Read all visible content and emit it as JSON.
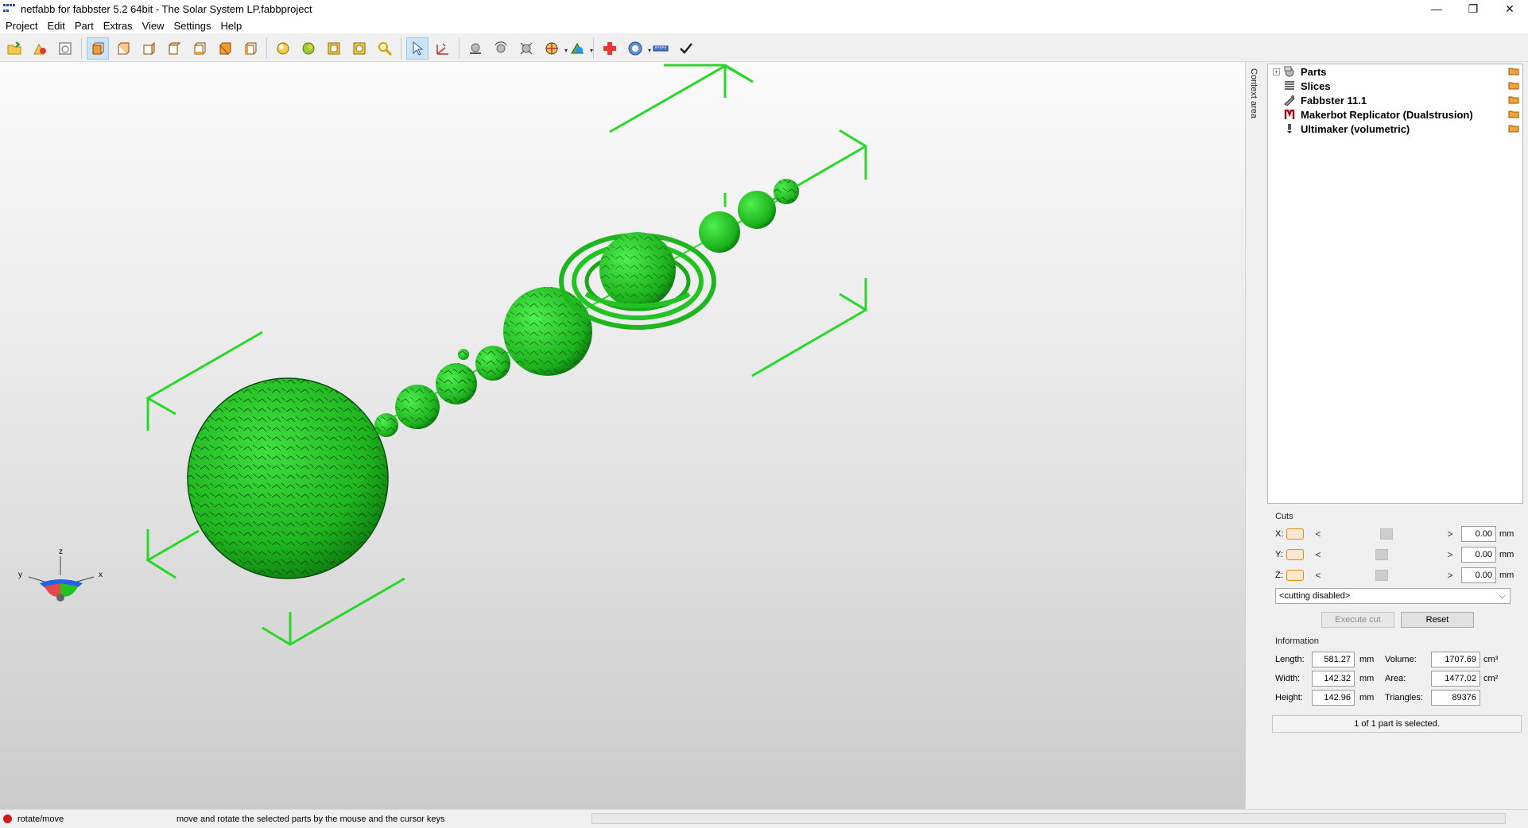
{
  "window": {
    "title": "netfabb for fabbster 5.2 64bit - The Solar System LP.fabbproject",
    "minimize": "—",
    "maximize": "❐",
    "close": "✕"
  },
  "menu": [
    "Project",
    "Edit",
    "Part",
    "Extras",
    "View",
    "Settings",
    "Help"
  ],
  "toolbar": {
    "groups": [
      [
        "open-project",
        "add-part",
        "new-window"
      ],
      [
        "view-front",
        "view-back",
        "view-left",
        "view-right",
        "view-top",
        "view-bottom",
        "view-perspective"
      ],
      [
        "rotate-view",
        "pan-view",
        "zoom-selection",
        "zoom-all",
        "zoom-icon"
      ],
      [
        "select-cursor",
        "move-tool"
      ],
      [
        "place-on-platform",
        "rotate-part",
        "scale-part",
        "section-view",
        "shading-mode"
      ],
      [
        "repair-cross",
        "analysis-menu",
        "measure-ruler",
        "checkmark"
      ]
    ]
  },
  "viewport": {
    "axis_labels": {
      "x": "x",
      "y": "y",
      "z": "z"
    },
    "colors": {
      "model": "#22c322",
      "bbox": "#28d828"
    }
  },
  "context_area_label": "Context area",
  "tree": {
    "items": [
      {
        "label": "Parts",
        "expandable": true,
        "expander": "+",
        "icon": "parts-icon"
      },
      {
        "label": "Slices",
        "expandable": false,
        "icon": "slices-icon"
      },
      {
        "label": "Fabbster 11.1",
        "expandable": false,
        "icon": "fabbster-icon"
      },
      {
        "label": "Makerbot Replicator (Dualstrusion)",
        "expandable": false,
        "icon": "makerbot-icon"
      },
      {
        "label": "Ultimaker (volumetric)",
        "expandable": false,
        "icon": "ultimaker-icon"
      }
    ]
  },
  "cuts": {
    "title": "Cuts",
    "rows": [
      {
        "axis": "X:",
        "value": "0.00",
        "unit": "mm",
        "position": 0.52
      },
      {
        "axis": "Y:",
        "value": "0.00",
        "unit": "mm",
        "position": 0.48
      },
      {
        "axis": "Z:",
        "value": "0.00",
        "unit": "mm",
        "position": 0.48
      }
    ],
    "left_arrow": "<",
    "right_arrow": ">",
    "mode_select": "<cutting disabled>",
    "mode_chevron": "⌵",
    "execute_label": "Execute cut",
    "reset_label": "Reset"
  },
  "information": {
    "title": "Information",
    "length_label": "Length:",
    "length": "581.27",
    "length_unit": "mm",
    "width_label": "Width:",
    "width": "142.32",
    "width_unit": "mm",
    "height_label": "Height:",
    "height": "142.96",
    "height_unit": "mm",
    "volume_label": "Volume:",
    "volume": "1707.69",
    "volume_unit": "cm³",
    "area_label": "Area:",
    "area": "1477.02",
    "area_unit": "cm²",
    "triangles_label": "Triangles:",
    "triangles": "89376"
  },
  "selection_status": "1 of 1 part is selected.",
  "statusbar": {
    "mode": "rotate/move",
    "description": "move and rotate the selected parts by the mouse and the cursor keys"
  }
}
